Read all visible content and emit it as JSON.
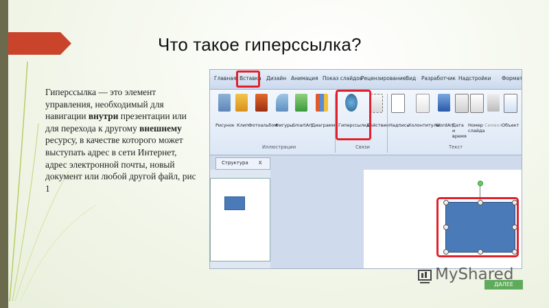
{
  "slide": {
    "title": "Что такое гиперссылка?",
    "body": [
      {
        "text": "Гиперссылка — это элемент управления, необходимый для навигации ",
        "bold": false
      },
      {
        "text": "внутри",
        "bold": true
      },
      {
        "text": " презентации или для перехода к другому ",
        "bold": false
      },
      {
        "text": "внешнему",
        "bold": true
      },
      {
        "text": " ресурсу, в качестве которого может выступать адрес в сети Интернет, адрес электронной почты, новый документ или любой другой файл, рис 1",
        "bold": false
      }
    ]
  },
  "screenshot": {
    "tabs": [
      "Главная",
      "Вставка",
      "Дизайн",
      "Анимация",
      "Показ слайдов",
      "Рецензирование",
      "Вид",
      "Разработчик",
      "Надстройки",
      "Формат"
    ],
    "ribbon_buttons": [
      "Рисунок",
      "Клип",
      "Фотоальбом",
      "Фигуры",
      "SmartArt",
      "Диаграмма",
      "Гиперссылка",
      "Действие",
      "Надпись",
      "Колонтитулы",
      "WordArt",
      "Дата и время",
      "Номер слайда",
      "Символ",
      "Объект"
    ],
    "groups": [
      "Иллюстрации",
      "Связи",
      "Текст"
    ],
    "pane_tab": "Структура",
    "pane_close": "x"
  },
  "watermark": {
    "brand": "MyShared",
    "button": "ДАЛЕЕ"
  },
  "colors": {
    "accent_red": "#e0202a",
    "shape_blue": "#4a7ab8",
    "arrow_red": "#c9442b",
    "bar": "#6b6a4c"
  }
}
